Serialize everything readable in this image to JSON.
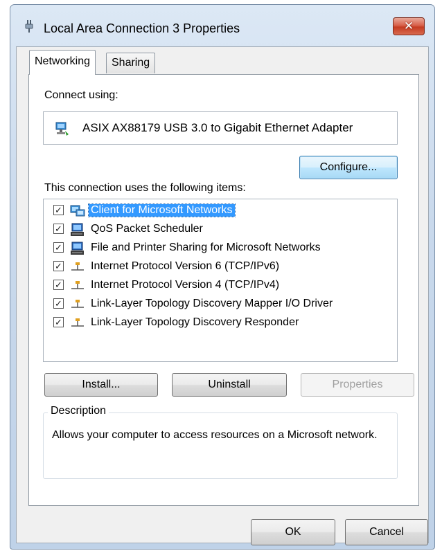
{
  "window": {
    "title": "Local Area Connection 3 Properties",
    "close_glyph": "✕"
  },
  "tabs": [
    {
      "label": "Networking",
      "active": true
    },
    {
      "label": "Sharing",
      "active": false
    }
  ],
  "connect_using": {
    "label": "Connect using:",
    "adapter": "ASIX AX88179 USB 3.0 to Gigabit Ethernet Adapter",
    "adapter_icon": "network-adapter-icon"
  },
  "configure_button": "Configure...",
  "items_label": "This connection uses the following items:",
  "items": [
    {
      "label": "Client for Microsoft Networks",
      "checked": true,
      "selected": true,
      "icon": "network-client-icon"
    },
    {
      "label": "QoS Packet Scheduler",
      "checked": true,
      "selected": false,
      "icon": "network-service-icon"
    },
    {
      "label": "File and Printer Sharing for Microsoft Networks",
      "checked": true,
      "selected": false,
      "icon": "network-service-icon"
    },
    {
      "label": "Internet Protocol Version 6 (TCP/IPv6)",
      "checked": true,
      "selected": false,
      "icon": "network-protocol-icon"
    },
    {
      "label": "Internet Protocol Version 4 (TCP/IPv4)",
      "checked": true,
      "selected": false,
      "icon": "network-protocol-icon"
    },
    {
      "label": "Link-Layer Topology Discovery Mapper I/O Driver",
      "checked": true,
      "selected": false,
      "icon": "network-protocol-icon"
    },
    {
      "label": "Link-Layer Topology Discovery Responder",
      "checked": true,
      "selected": false,
      "icon": "network-protocol-icon"
    }
  ],
  "buttons": {
    "install": "Install...",
    "uninstall": "Uninstall",
    "properties": "Properties",
    "ok": "OK",
    "cancel": "Cancel"
  },
  "description": {
    "legend": "Description",
    "text": "Allows your computer to access resources on a Microsoft network."
  },
  "colors": {
    "selection": "#3399ff",
    "close_button": "#c53c22"
  }
}
